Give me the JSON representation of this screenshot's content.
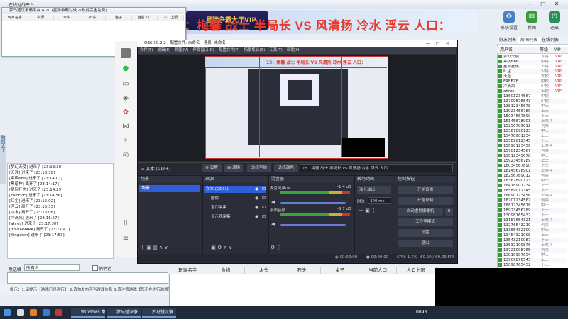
{
  "app": {
    "title": "在线对战平台",
    "banner_title": "15：梅馨 战士 半局长 VS 风清扬 冷水 浮云 人口：",
    "logo_text": "星际争霸大厅VIP",
    "toolbar": [
      {
        "label": "系统设置",
        "icon": "gear-icon"
      },
      {
        "label": "新闻",
        "icon": "news-icon"
      },
      {
        "label": "退出",
        "icon": "exit-icon"
      }
    ],
    "window_controls": [
      "—",
      "□",
      "✕"
    ]
  },
  "small_window": {
    "title": "梦马楚汉争霸平台 4.70 (星际争霸对战 本软件完全免费)",
    "columns": [
      "玩家名字",
      "资源",
      "木头",
      "石头",
      "金子",
      "当前人口",
      "人口上限"
    ]
  },
  "side_panel": {
    "label": "新闻天下"
  },
  "chat_log": [
    "[梦幻天使] 进来了 [23:13:30]",
    "[天涯] 进来了 [23:13:38]",
    "[寒夜666] 进来了 [23:14:07]",
    "[黑暗神] 离开了 [23:14:17]",
    "[星际狂热] 进来了 [23:14:29]",
    "[FREEZE] 进来了 [23:14:56]",
    "[红尘] 进来了 [23:15:02]",
    "[浮云] 离开了 [23:15:33]",
    "[冷水] 离开了 [23:16:08]",
    "[冷清风] 进来了 [23:16:57]",
    "[ahres] 进来了 [23:17:30]",
    "[3370994RA] 离开了 [23:17:47]",
    "[Kingdom] 进来了 [23:17:53]"
  ],
  "chat_controls": {
    "send_target_label": "发送给",
    "send_target_value": "所有人",
    "private_label": "悄悄话"
  },
  "tip_bar": "提示：1.请提示【游戏已经运行】 2.请勿发布不当游戏信息 3.请注意游戏【您正在进行游戏】4.游戏中...",
  "result_table": {
    "columns": [
      "玩家名字",
      "食物",
      "木头",
      "石头",
      "金子",
      "当前人口",
      "人口上限"
    ]
  },
  "right_panel": {
    "tabs": [
      "好友列表",
      "房间列表",
      "在线列表"
    ],
    "headers": [
      "用户名",
      "等级",
      "VIP"
    ],
    "players": [
      [
        "梦幻天使",
        "大将",
        "VIP"
      ],
      [
        "寒夜666",
        "中将",
        "VIP"
      ],
      [
        "星际狂热",
        "上将",
        "VIP"
      ],
      [
        "红尘",
        "少将",
        "VIP"
      ],
      [
        "天涯",
        "大校",
        "VIP"
      ],
      [
        "FREEZE",
        "中校",
        "VIP"
      ],
      [
        "冷清风",
        "少校",
        "VIP"
      ],
      [
        "ahres",
        "上尉",
        "VIP"
      ],
      [
        "13601234567",
        "中尉",
        ""
      ],
      [
        "13709876543",
        "少尉",
        ""
      ],
      [
        "13812345678",
        "中士",
        ""
      ],
      [
        "13923456789",
        "上士",
        ""
      ],
      [
        "15034567890",
        "下士",
        ""
      ],
      [
        "15145678901",
        "上等兵",
        ""
      ],
      [
        "15256789012",
        "列兵",
        ""
      ],
      [
        "15367890123",
        "中士",
        ""
      ],
      [
        "15478901234",
        "上士",
        ""
      ],
      [
        "15589012345",
        "下士",
        ""
      ],
      [
        "15690123456",
        "上等兵",
        ""
      ],
      [
        "15701234567",
        "列兵",
        ""
      ],
      [
        "15812345678",
        "中士",
        ""
      ],
      [
        "15923456789",
        "上士",
        ""
      ],
      [
        "18034567890",
        "下士",
        ""
      ],
      [
        "18145678901",
        "上等兵",
        ""
      ],
      [
        "18256789012",
        "列兵",
        ""
      ],
      [
        "18367890123",
        "中士",
        ""
      ],
      [
        "18478901234",
        "上士",
        ""
      ],
      [
        "18589012345",
        "下士",
        ""
      ],
      [
        "18690123456",
        "上等兵",
        ""
      ],
      [
        "18701234567",
        "列兵",
        ""
      ],
      [
        "18812345678",
        "中士",
        ""
      ],
      [
        "18923456789",
        "上士",
        ""
      ],
      [
        "13098765432",
        "下士",
        ""
      ],
      [
        "13187654321",
        "上等兵",
        ""
      ],
      [
        "13276543210",
        "列兵",
        ""
      ],
      [
        "13365432109",
        "中士",
        ""
      ],
      [
        "13454321098",
        "上士",
        ""
      ],
      [
        "13543210987",
        "下士",
        ""
      ],
      [
        "13632109876",
        "上等兵",
        ""
      ],
      [
        "13721098765",
        "列兵",
        ""
      ],
      [
        "13810987654",
        "中士",
        ""
      ],
      [
        "13909876543",
        "上士",
        ""
      ],
      [
        "15098765432",
        "下士",
        ""
      ],
      [
        "15187654321",
        "上等兵",
        ""
      ],
      [
        "15276543210",
        "列兵",
        ""
      ],
      [
        "15365432109",
        "中士",
        ""
      ],
      [
        "15454321098",
        "上士",
        ""
      ],
      [
        "15543210987",
        "下士",
        ""
      ]
    ]
  },
  "obs": {
    "title": "OBS 30.2.2 - 配置文件: 未命名 - 场景: 未命名",
    "menu": [
      "文件(F)",
      "编辑(E)",
      "视图(V)",
      "停靠窗口(D)",
      "配置文件(P)",
      "场景集合(S)",
      "工具(T)",
      "帮助(H)"
    ],
    "source_toolbar": {
      "source_name": "文本 (GDI+)",
      "properties": "设置",
      "filters": "滤镜",
      "select_font": "选择字体",
      "select_color": "选择颜色",
      "text_value": "15：梅馨 战士 半局长 VS 风清扬 冷水 浮云 人口："
    },
    "docks": {
      "scenes": "场景",
      "sources": "来源",
      "mixer": "混音器",
      "transitions": "转场动画",
      "controls": "控制按钮"
    },
    "scenes": [
      "场景"
    ],
    "sources": [
      "文本 (GDI+)",
      "图像",
      "窗口采集",
      "显示器采集"
    ],
    "mixer": [
      {
        "name": "麦克风/Aux",
        "db": "-1.4 dB"
      },
      {
        "name": "桌面音频",
        "db": "-5.7 dB"
      }
    ],
    "transition": {
      "type": "淡入淡出",
      "duration_label": "时长",
      "duration": "300 ms"
    },
    "controls": [
      "开始直播",
      "开始录制",
      "启动虚拟摄像机",
      "工作室模式",
      "设置",
      "退出"
    ],
    "status": {
      "live": "00:00:00",
      "rec": "00:00:00",
      "cpu": "CPU: 1.7%",
      "fps": "60.00 / 60.00 FPS"
    }
  },
  "taskbar": {
    "items": [
      "Windows 桌...",
      "梦马楚汉争...",
      "梦马楚汉争..."
    ],
    "extra": "0093..."
  },
  "colors": {
    "obs_bg": "#2b2e38",
    "accent": "#2f5ed6",
    "banner_red": "#e53a2e"
  }
}
